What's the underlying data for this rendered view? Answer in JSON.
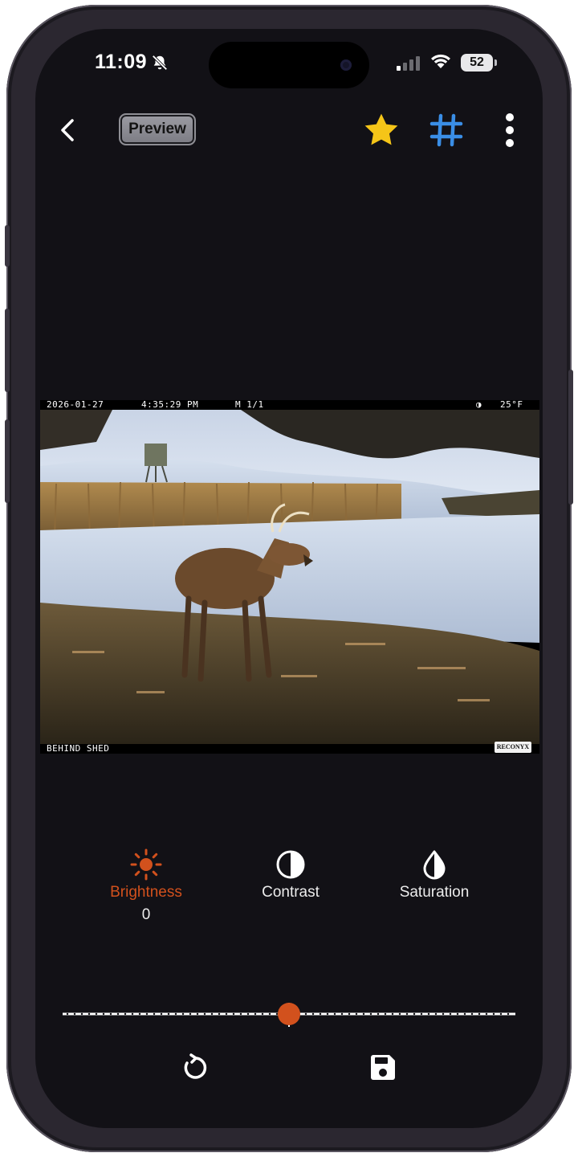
{
  "status_bar": {
    "time": "11:09",
    "battery": "52",
    "icons": [
      "bell-slash-icon",
      "signal-icon",
      "wifi-icon",
      "battery-icon"
    ]
  },
  "toolbar": {
    "title": "Preview",
    "icons": [
      "chevron-left-icon",
      "star-icon",
      "hashtag-icon",
      "more-vertical-icon"
    ],
    "star_color": "#f5c518",
    "grid_color": "#3a8ee6"
  },
  "photo": {
    "date": "2026-01-27",
    "time": "4:35:29 PM",
    "sequence": "M 1/1",
    "moon": "◑",
    "temperature": "25°F",
    "location": "BEHIND SHED",
    "brand": "RECONYX"
  },
  "adjustments": {
    "tools": [
      {
        "label": "Brightness",
        "icon": "sun-icon",
        "active": true
      },
      {
        "label": "Contrast",
        "icon": "contrast-icon",
        "active": false
      },
      {
        "label": "Saturation",
        "icon": "droplet-half-icon",
        "active": false
      }
    ],
    "active_value": "0",
    "accent_color": "#d2511d",
    "slider_fraction": 0.5
  },
  "actions": {
    "icons": [
      "reset-icon",
      "save-icon"
    ]
  }
}
